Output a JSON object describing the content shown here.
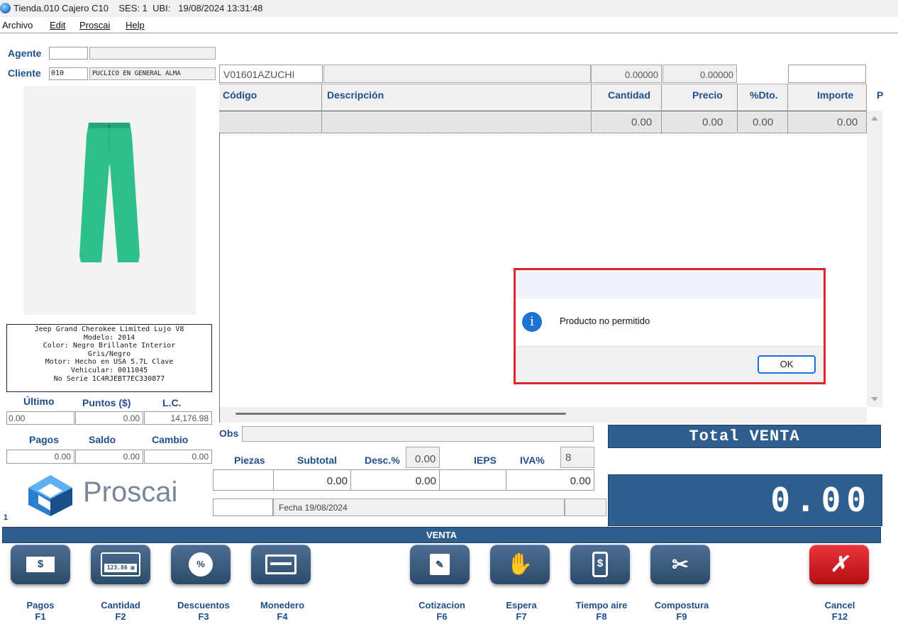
{
  "window": {
    "title": "Tienda.010 Cajero C10",
    "session": "SES: 1",
    "location": "UBI:",
    "datetime": "19/08/2024 13:31:48"
  },
  "menu": {
    "items": [
      "Archivo",
      "Edit",
      "Proscai",
      "Help"
    ]
  },
  "left": {
    "agente_label": "Agente",
    "cliente_label": "Cliente",
    "cliente_code": "010",
    "cliente_name": "PUCLICO EN GENERAL ALMA",
    "product_desc": "Jeep Grand Cherokee Limited Lujo V8\nModelo: 2014\nColor: Negro Brillante Interior\nGris/Negro\nMotor: Hecho en USA 5.7L   Clave\nVehicular: 0011045\nNo Serie 1C4RJEBT7EC330877",
    "ultimo_label": "Último",
    "puntos_label": "Puntos ($)",
    "lc_label": "L.C.",
    "ultimo_value": "0.00",
    "puntos_value": "0.00",
    "lc_value": "14,176.98",
    "pagos_label": "Pagos",
    "saldo_label": "Saldo",
    "cambio_label": "Cambio",
    "pagos_value": "0.00",
    "saldo_value": "0.00",
    "cambio_value": "0.00",
    "logo_text": "Proscai",
    "counter": "1"
  },
  "grid": {
    "vendor": "V01601AZUCHI",
    "rate1": "0.00000",
    "rate2": "0.00000",
    "headers": {
      "codigo": "Código",
      "descripcion": "Descripción",
      "cantidad": "Cantidad",
      "precio": "Precio",
      "dto": "%Dto.",
      "importe": "Importe",
      "extra": "P"
    },
    "row": {
      "cantidad": "0.00",
      "precio": "0.00",
      "dto": "0.00",
      "importe": "0.00"
    }
  },
  "dialog": {
    "message": "Producto no permitido",
    "ok_label": "OK"
  },
  "summary": {
    "obs_label": "Obs",
    "piezas_label": "Piezas",
    "subtotal_label": "Subtotal",
    "desc_label": "Desc.%",
    "desc_value": "0.00",
    "ieps_label": "IEPS",
    "iva_label": "IVA%",
    "iva_value": "8",
    "subtotal_value": "0.00",
    "desc_amount": "0.00",
    "iva_amount": "0.00",
    "fecha": "Fecha 19/08/2024",
    "total_label": "Total VENTA",
    "total_value": "0.00"
  },
  "status": {
    "mode": "VENTA"
  },
  "buttons": [
    {
      "label": "Pagos",
      "key": "F1",
      "icon": "dollar-card-icon"
    },
    {
      "label": "Cantidad",
      "key": "F2",
      "icon": "calculator-icon"
    },
    {
      "label": "Descuentos",
      "key": "F3",
      "icon": "percent-badge-icon"
    },
    {
      "label": "Monedero",
      "key": "F4",
      "icon": "wallet-card-icon"
    },
    {
      "label": "Cotizacion",
      "key": "F6",
      "icon": "quote-edit-icon"
    },
    {
      "label": "Espera",
      "key": "F7",
      "icon": "hand-icon"
    },
    {
      "label": "Tiempo aire",
      "key": "F8",
      "icon": "phone-dollar-icon"
    },
    {
      "label": "Compostura",
      "key": "F9",
      "icon": "scissors-icon"
    },
    {
      "label": "Cancel",
      "key": "F12",
      "icon": "cancel-x-icon"
    }
  ],
  "colors": {
    "accent_blue": "#2f5f8f",
    "label_blue": "#1f4e8a",
    "product_green": "#2fbf8a",
    "dialog_border": "#e0242b",
    "cancel_red": "#d9171e"
  }
}
